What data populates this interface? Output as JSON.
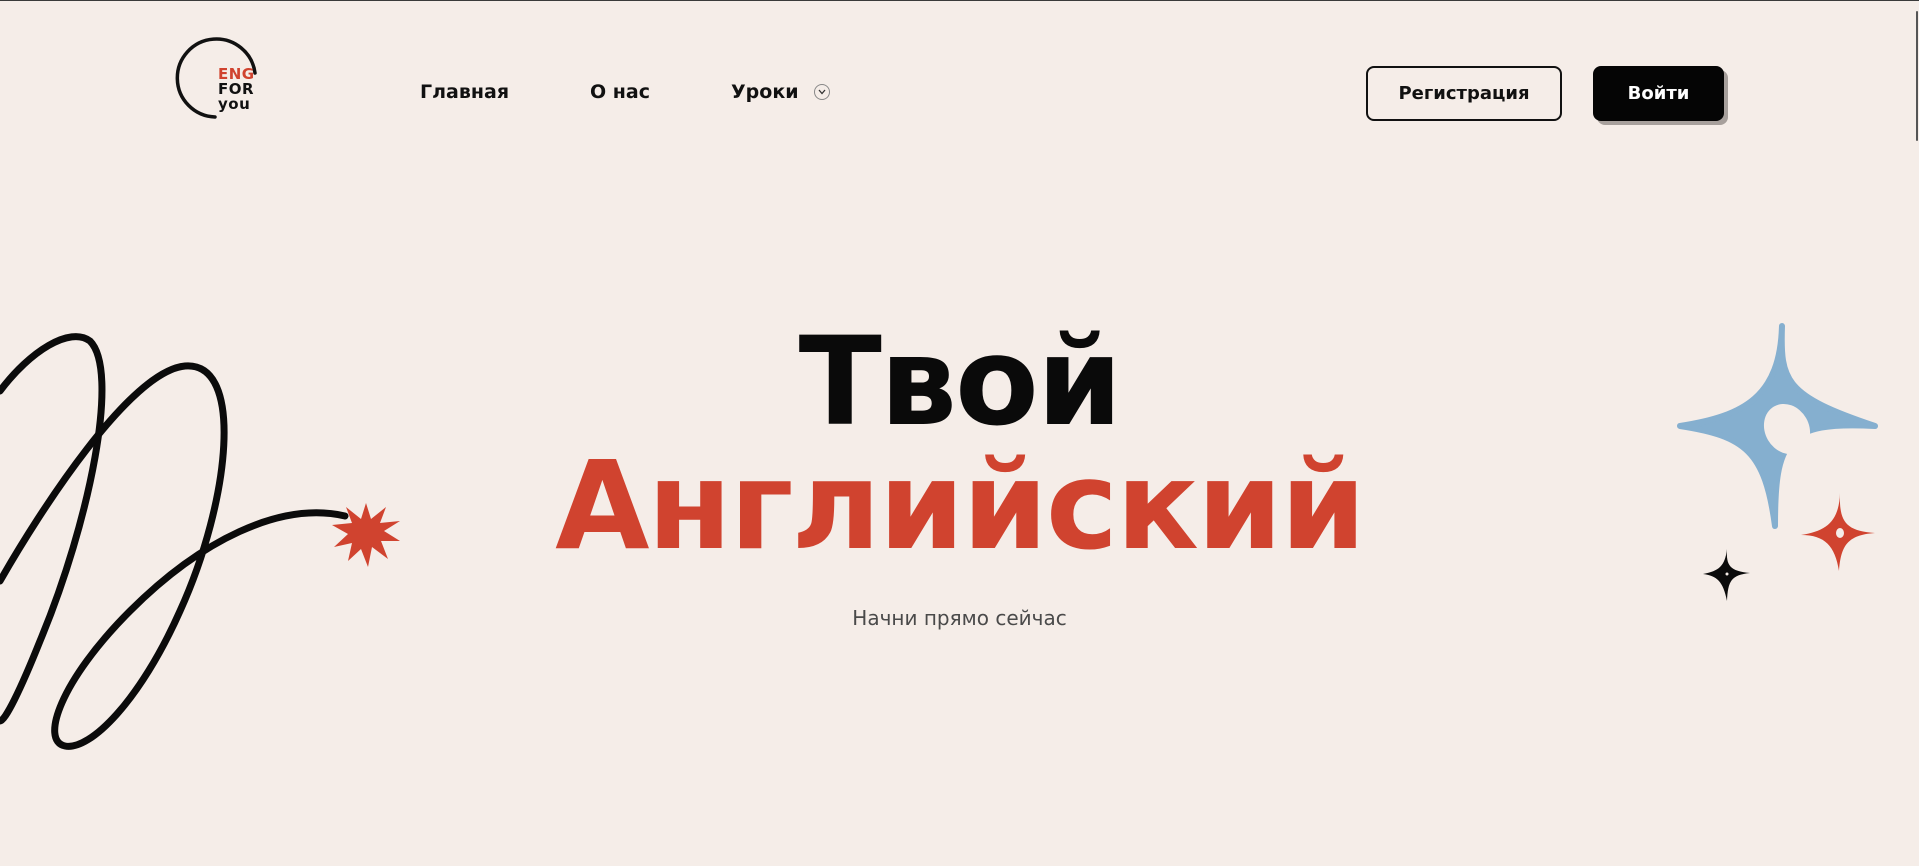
{
  "logo": {
    "line1": "ENG",
    "line2": "FOR",
    "line3": "you"
  },
  "nav": {
    "items": [
      {
        "label": "Главная"
      },
      {
        "label": "О нас"
      },
      {
        "label": "Уроки",
        "has_dropdown": true
      }
    ]
  },
  "auth": {
    "register_label": "Регистрация",
    "login_label": "Войти"
  },
  "hero": {
    "title_line1": "Твой",
    "title_line2": "Английский",
    "subtitle": "Начни прямо сейчас"
  },
  "colors": {
    "background": "#f5ede8",
    "accent_red": "#d0432f",
    "accent_blue": "#85afcf",
    "text_dark": "#0a0a0a"
  },
  "icons": {
    "dropdown": "chevron-down-icon",
    "decor_left": "squiggle-line-icon",
    "decor_burst": "starburst-icon",
    "decor_right": "sparkle-stars-icon"
  }
}
